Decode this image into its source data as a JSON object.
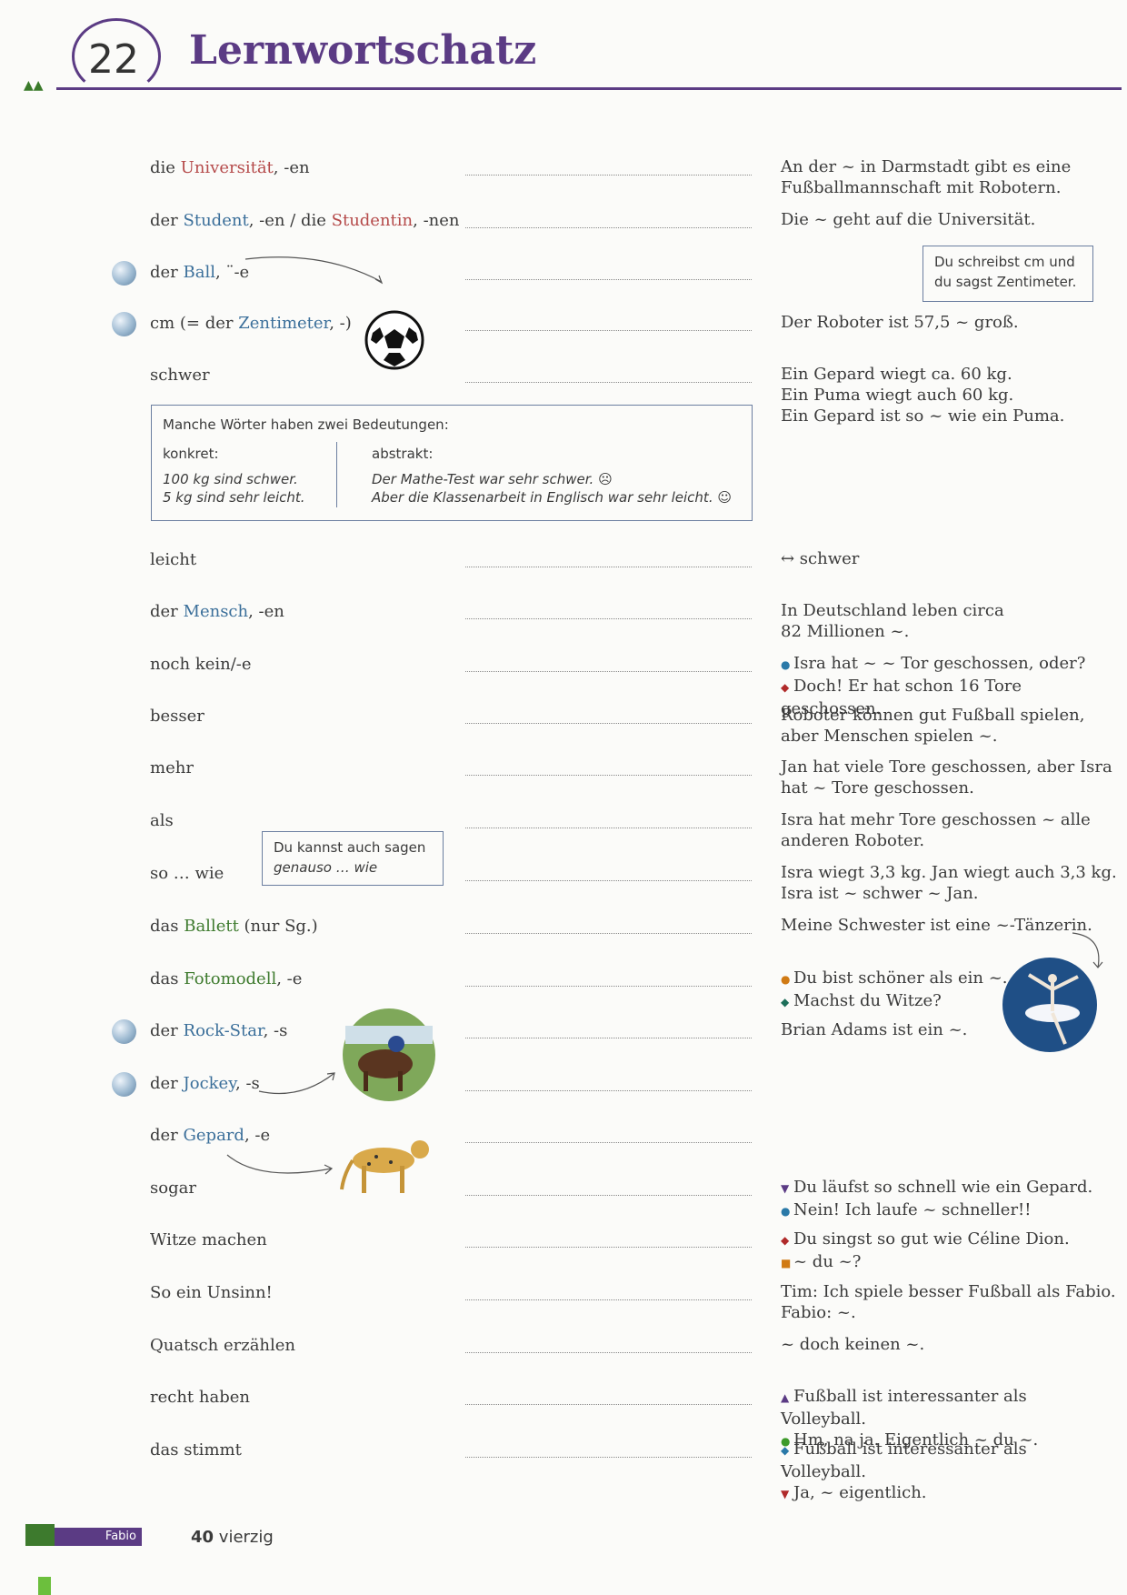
{
  "header": {
    "chapter": "22",
    "title": "Lernwortschatz"
  },
  "info_box": {
    "heading": "Manche Wörter haben zwei Bedeutungen:",
    "left_label": "konkret:",
    "left_lines": [
      "100 kg sind schwer.",
      "5 kg sind sehr leicht."
    ],
    "right_label": "abstrakt:",
    "right_lines": [
      "Der Mathe-Test war sehr schwer.",
      "Aber die Klassenarbeit in Englisch war sehr leicht."
    ]
  },
  "callouts": {
    "cm": [
      "Du schreibst cm und",
      "du sagst Zentimeter."
    ],
    "genauso": [
      "Du kannst auch sagen",
      "genauso … wie"
    ]
  },
  "entries": [
    {
      "pre": "die ",
      "word": "Universität",
      "post": ", -en",
      "ex": [
        "An der ~ in Darmstadt gibt es eine",
        "Fußballmannschaft mit Robotern."
      ]
    },
    {
      "pre": "der ",
      "word": "Student",
      "post": ", -en / die ",
      "word2": "Studentin",
      "post2": ", -nen",
      "ex": [
        "Die ~ geht auf die Universität."
      ]
    },
    {
      "pre": "der ",
      "word": "Ball",
      "post": ", ¨-e",
      "ex": []
    },
    {
      "pre": "cm (= der ",
      "word": "Zentimeter",
      "post": ", -)",
      "ex": [
        "Der Roboter ist 57,5 ~ groß."
      ]
    },
    {
      "pre": "schwer",
      "ex": [
        "Ein Gepard wiegt ca. 60 kg.",
        "Ein Puma wiegt auch 60 kg.",
        "Ein Gepard ist so ~ wie ein Puma."
      ]
    },
    {
      "pre": "leicht",
      "ex": [
        "↔ schwer"
      ]
    },
    {
      "pre": "der ",
      "word": "Mensch",
      "post": ", -en",
      "ex": [
        "In Deutschland leben circa",
        "82 Millionen ~."
      ]
    },
    {
      "pre": "noch kein/-e",
      "ex": [
        "Isra hat ~ ~ Tor geschossen, oder?",
        "Doch! Er hat schon 16 Tore geschossen."
      ]
    },
    {
      "pre": "besser",
      "ex": [
        "Roboter können gut Fußball spielen,",
        "aber Menschen spielen ~."
      ]
    },
    {
      "pre": "mehr",
      "ex": [
        "Jan hat viele Tore geschossen, aber Isra",
        "hat ~ Tore geschossen."
      ]
    },
    {
      "pre": "als",
      "ex": [
        "Isra hat mehr Tore geschossen ~ alle",
        "anderen Roboter."
      ]
    },
    {
      "pre": "so … wie",
      "ex": [
        "Isra wiegt 3,3 kg. Jan wiegt auch 3,3 kg.",
        "Isra ist ~ schwer ~ Jan."
      ]
    },
    {
      "pre": "das ",
      "word": "Ballett",
      "post": " (nur Sg.)",
      "ex": [
        "Meine Schwester ist eine ~-Tänzerin."
      ]
    },
    {
      "pre": "das ",
      "word": "Fotomodell",
      "post": ", -e",
      "ex": [
        "Du bist schöner als ein ~.",
        "Machst du Witze?"
      ]
    },
    {
      "pre": "der ",
      "word": "Rock-Star",
      "post": ", -s",
      "ex": [
        "Brian Adams ist ein ~."
      ]
    },
    {
      "pre": "der ",
      "word": "Jockey",
      "post": ", -s",
      "ex": []
    },
    {
      "pre": "der ",
      "word": "Gepard",
      "post": ", -e",
      "ex": []
    },
    {
      "pre": "sogar",
      "ex": [
        "Du läufst so schnell wie ein Gepard.",
        "Nein! Ich laufe ~ schneller!!"
      ]
    },
    {
      "pre": "Witze machen",
      "ex": [
        "Du singst so gut wie Céline Dion.",
        "~ du ~?"
      ]
    },
    {
      "pre": "So ein Unsinn!",
      "ex": [
        "Tim: Ich spiele besser Fußball als Fabio.",
        "Fabio: ~."
      ]
    },
    {
      "pre": "Quatsch erzählen",
      "ex": [
        "~ doch keinen ~."
      ]
    },
    {
      "pre": "recht haben",
      "ex": [
        "Fußball ist interessanter als Volleyball.",
        "Hm, na ja. Eigentlich ~ du ~."
      ]
    },
    {
      "pre": "das stimmt",
      "ex": [
        "Fußball ist interessanter als Volleyball.",
        "Ja, ~ eigentlich."
      ]
    }
  ],
  "footer": {
    "name": "Fabio",
    "page_number": "40",
    "page_word": "vierzig"
  }
}
